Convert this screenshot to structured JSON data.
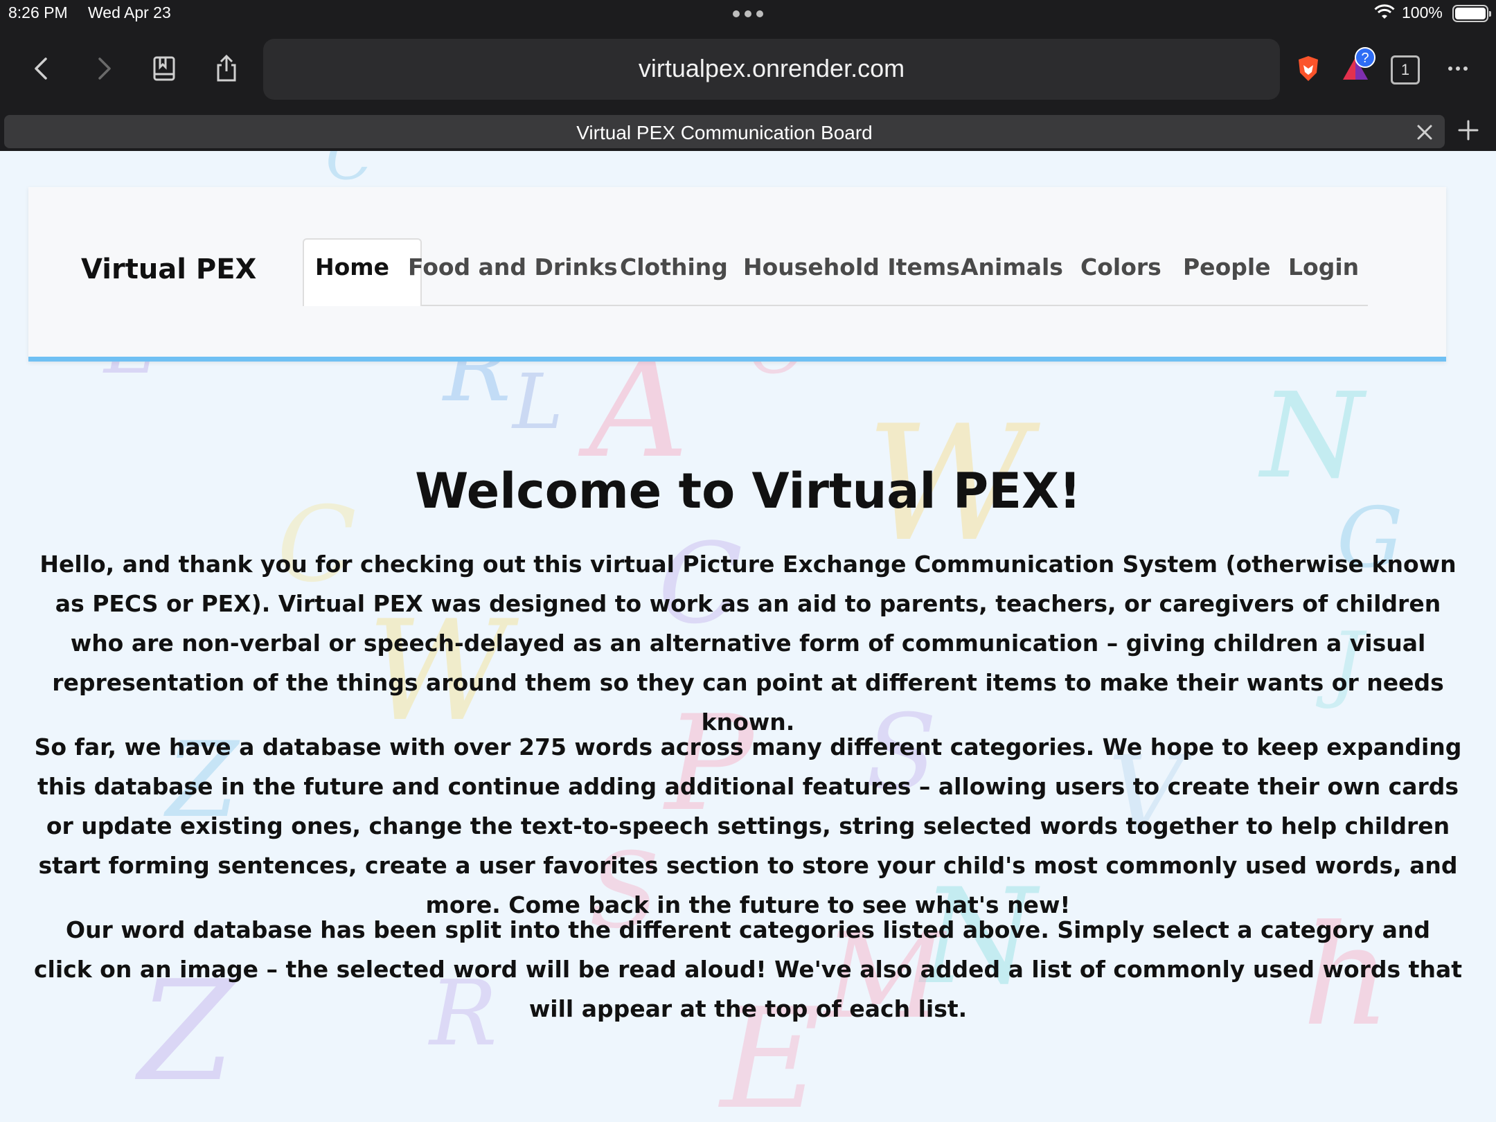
{
  "status_bar": {
    "time": "8:26 PM",
    "date": "Wed Apr 23",
    "battery_percent": "100%"
  },
  "browser": {
    "url": "virtualpex.onrender.com",
    "tab_count": "1",
    "notification_badge": "?",
    "tab_title": "Virtual PEX Communication Board"
  },
  "nav": {
    "brand": "Virtual PEX",
    "tabs": [
      {
        "label": "Home",
        "active": true
      },
      {
        "label": "Food and Drinks"
      },
      {
        "label": "Clothing"
      },
      {
        "label": "Household Items"
      },
      {
        "label": "Animals"
      },
      {
        "label": "Colors"
      },
      {
        "label": "People"
      },
      {
        "label": "Login"
      }
    ],
    "accent_color": "#6fc0f3"
  },
  "main": {
    "heading": "Welcome to Virtual PEX!",
    "paragraph_1": "Hello, and thank you for checking out this virtual Picture Exchange Communication System (otherwise known as PECS or PEX). Virtual PEX was designed to work as an aid to parents, teachers, or caregivers of children who are non-verbal or speech-delayed as an alternative form of communication – giving children a visual representation of the things around them so they can point at different items to make their wants or needs known.",
    "paragraph_2": "So far, we have a database with over 275 words across many different categories. We hope to keep expanding this database in the future and continue adding additional features – allowing users to create their own cards or update existing ones, change the text-to-speech settings, string selected words together to help children start forming sentences, create a user favorites section to store your child's most commonly used words, and more. Come back in the future to see what's new!",
    "paragraph_3": "Our word database has been split into the different categories listed above. Simply select a category and click on an image – the selected word will be read aloud! We've also added a list of commonly used words that will appear at the top of each list."
  }
}
